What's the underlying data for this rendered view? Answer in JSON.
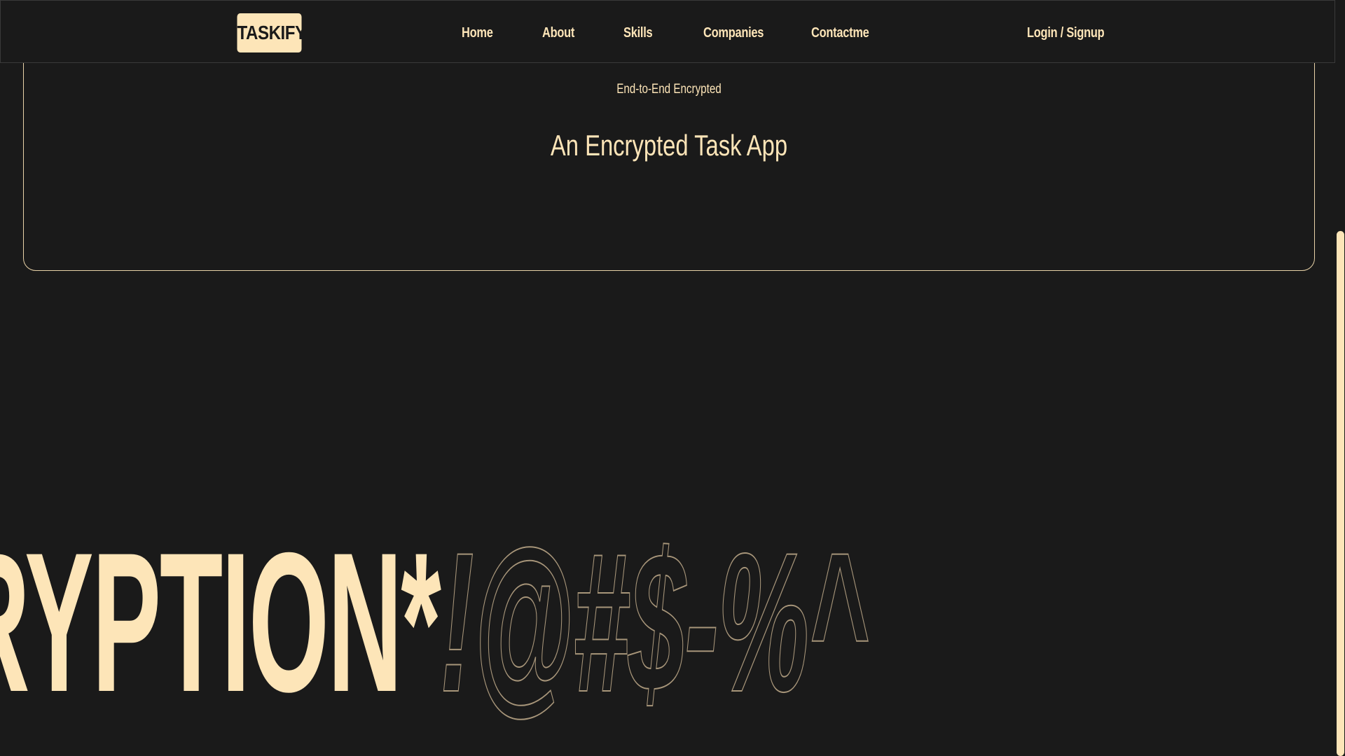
{
  "navbar": {
    "logo": "TASKIFY",
    "links": {
      "home": "Home",
      "about": "About",
      "skills": "Skills",
      "companies": "Companies",
      "contact": "Contactme"
    },
    "auth": "Login / Signup"
  },
  "hero": {
    "subtitle": "End-to-End Encrypted",
    "title": "An Encrypted Task App"
  },
  "marquee": {
    "solid_text": "RYPTION*",
    "outline_text": "!@#$-%^"
  },
  "colors": {
    "background": "#1a1a1a",
    "accent": "#fde5b8",
    "outline": "#a8967a"
  },
  "scroll": {
    "position_fraction": 0.7
  }
}
